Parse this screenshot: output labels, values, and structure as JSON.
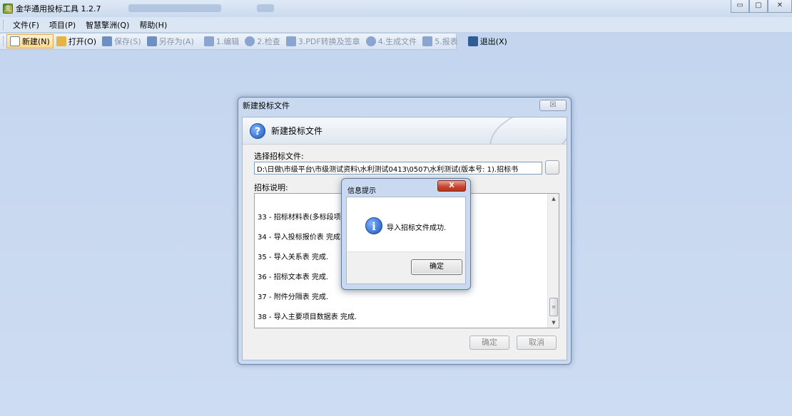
{
  "window": {
    "title": "金华通用投标工具 1.2.7",
    "controls": [
      "▭",
      "▢",
      "✕"
    ]
  },
  "menu": {
    "items": [
      "文件(F)",
      "项目(P)",
      "智慧擎洲(Q)",
      "帮助(H)"
    ]
  },
  "toolbar": {
    "new": "新建(N)",
    "open": "打开(O)",
    "save": "保存(S)",
    "save_as": "另存为(A)",
    "edit": "1.编辑",
    "check": "2.检查",
    "pdf": "3.PDF转换及签章",
    "generate": "4.生成文件",
    "report": "5.报表",
    "exit": "退出(X)"
  },
  "dialog": {
    "title": "新建投标文件",
    "close": "☒",
    "banner": "新建投标文件",
    "select_label": "选择招标文件:",
    "path_value": "D:\\日做\\市级平台\\市级测试资料\\水利测试0413\\0507\\水利测试(版本号: 1).招标书",
    "desc_label": "招标说明:",
    "log_lines": [
      "33 - 招标材料表(多标段项目",
      "34 - 导入投标报价表 完成.",
      "35 - 导入关系表 完成.",
      "36 - 招标文本表 完成.",
      "37 - 附件分隔表 完成.",
      "38 - 导入主要项目数据表 完成."
    ],
    "ok": "确定",
    "cancel": "取消"
  },
  "popup": {
    "title": "信息提示",
    "close": "X",
    "message": "导入招标文件成功.",
    "ok": "确定"
  }
}
